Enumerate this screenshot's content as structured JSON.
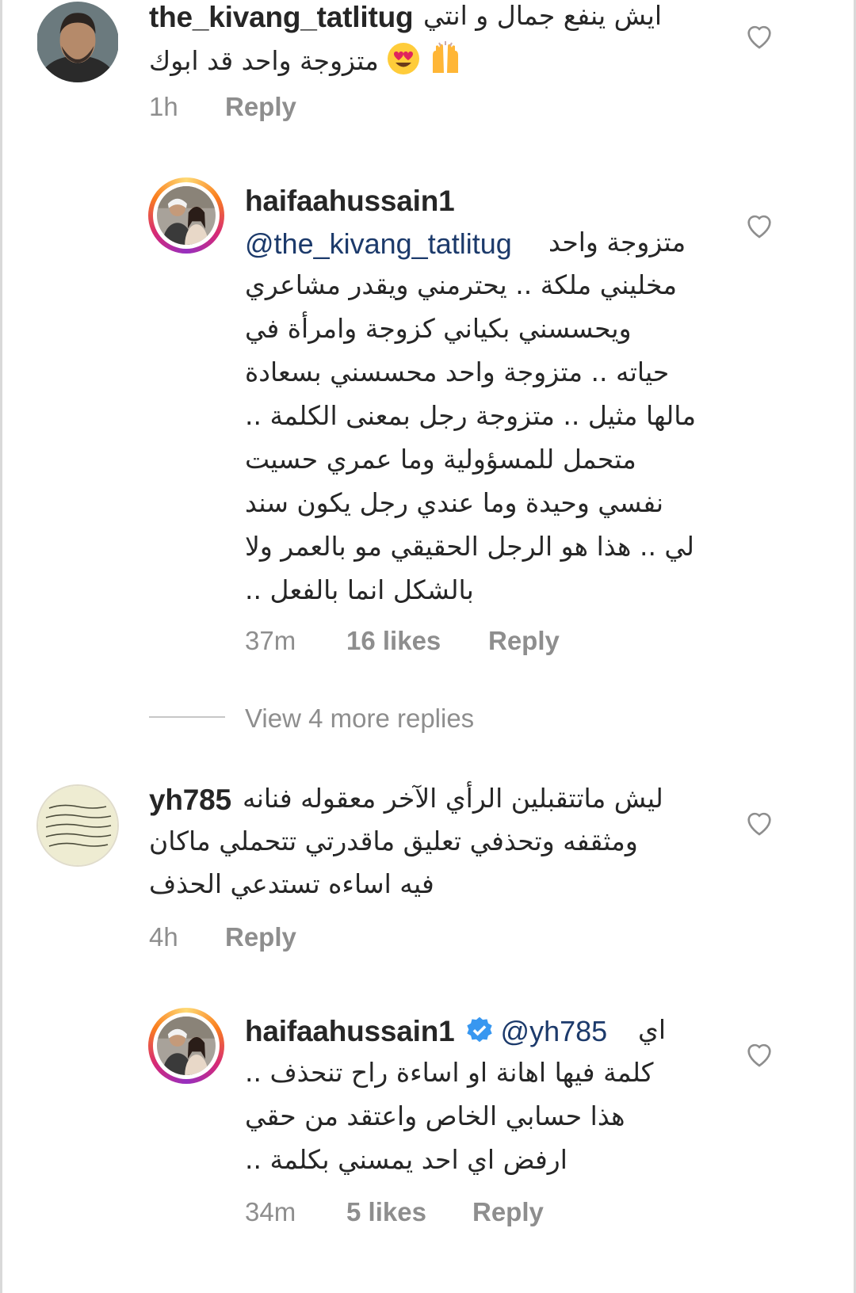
{
  "comments": [
    {
      "username": "the_kivang_tatlitug",
      "text_lines": [
        "ايش ينفع جمال و انتي",
        "متزوجة واحد قد ابوك"
      ],
      "emojis": [
        "raising-hands-emoji",
        "heart-eyes-emoji"
      ],
      "time": "1h",
      "reply_label": "Reply",
      "avatar": "man-beard-photo"
    },
    {
      "username": "haifaahussain1",
      "mention": "@the_kivang_tatlitug",
      "text_lines": [
        "متزوجة واحد",
        "مخليني ملكة .. يحترمني ويقدر مشاعري",
        "ويحسسني بكياني كزوجة وامرأة في",
        "حياته .. متزوجة واحد محسسني بسعادة",
        "مالها مثيل .. متزوجة رجل بمعنى الكلمة ..",
        "متحمل للمسؤولية وما عمري حسيت",
        "نفسي وحيدة وما عندي رجل يكون سند",
        "لي .. هذا هو الرجل الحقيقي مو بالعمر ولا",
        "بالشكل انما بالفعل .."
      ],
      "time": "37m",
      "likes": "16 likes",
      "reply_label": "Reply",
      "avatar": "couple-story-ring"
    },
    {
      "view_more": "View 4 more replies"
    },
    {
      "username": "yh785",
      "text_lines": [
        "ليش ماتتقبلين الرأي الآخر معقوله فنانه",
        "ومثقفه وتحذفي تعليق ماقدرتي تتحملي ماكان",
        "فيه اساءه تستدعي الحذف"
      ],
      "time": "4h",
      "reply_label": "Reply",
      "avatar": "calligraphy-paper"
    },
    {
      "username": "haifaahussain1",
      "verified": true,
      "mention": "@yh785",
      "text_lines": [
        "اي",
        "كلمة فيها اهانة او اساءة راح تنحذف ..",
        "هذا حسابي الخاص واعتقد من حقي",
        "ارفض اي احد يمسني بكلمة .."
      ],
      "time": "34m",
      "likes": "5 likes",
      "reply_label": "Reply",
      "avatar": "couple-story-ring"
    }
  ],
  "colors": {
    "text": "#262626",
    "meta": "#8e8e8e",
    "mention": "#1c3a6b",
    "verified": "#3897f0"
  }
}
